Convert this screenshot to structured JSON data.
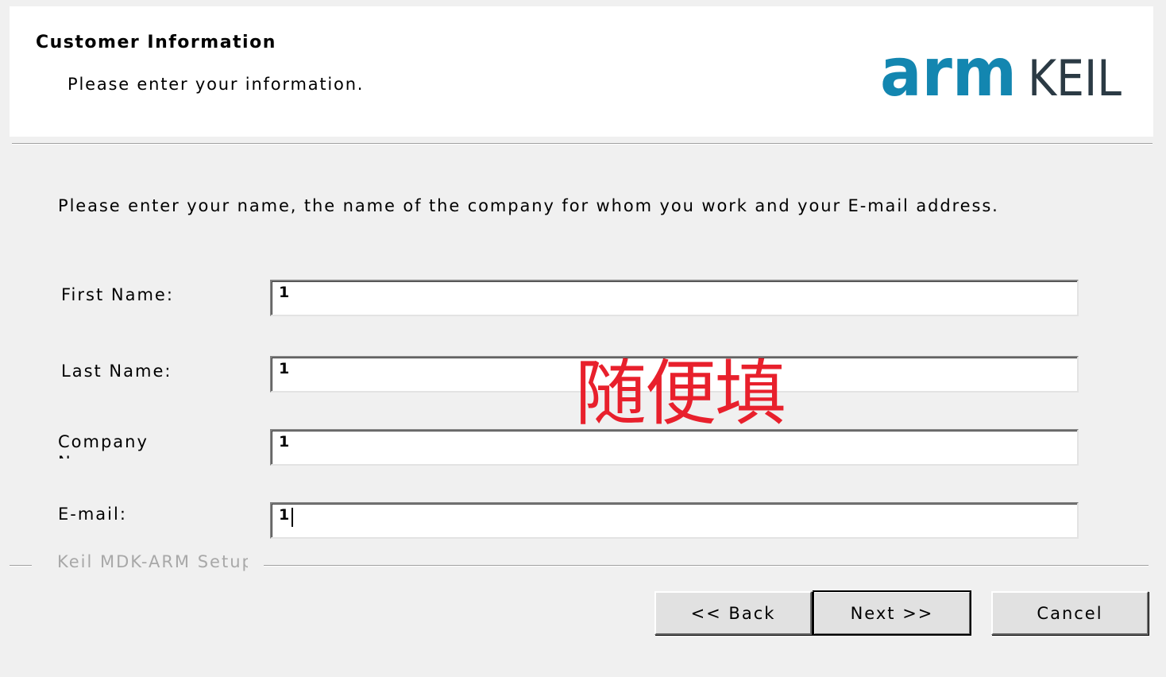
{
  "header": {
    "title": "Customer Information",
    "subtitle": "Please enter your information.",
    "logo": {
      "brand": "arm",
      "product": "KEIL",
      "brand_color": "#1386b0",
      "product_color": "#2b3a44"
    }
  },
  "intro": "Please enter your name, the name of the company for whom you work and your E-mail address.",
  "fields": {
    "first_name": {
      "label": "First Name:",
      "value": "1"
    },
    "last_name": {
      "label": "Last Name:",
      "value": "1"
    },
    "company": {
      "label": "Company Name:",
      "value": "1"
    },
    "email": {
      "label": "E-mail:",
      "value": "1"
    }
  },
  "annotation": {
    "text": "随便填",
    "color": "#e8202c"
  },
  "footer": {
    "brand": "Keil MDK-ARM Setup"
  },
  "buttons": {
    "back": "<< Back",
    "next": "Next >>",
    "cancel": "Cancel"
  }
}
